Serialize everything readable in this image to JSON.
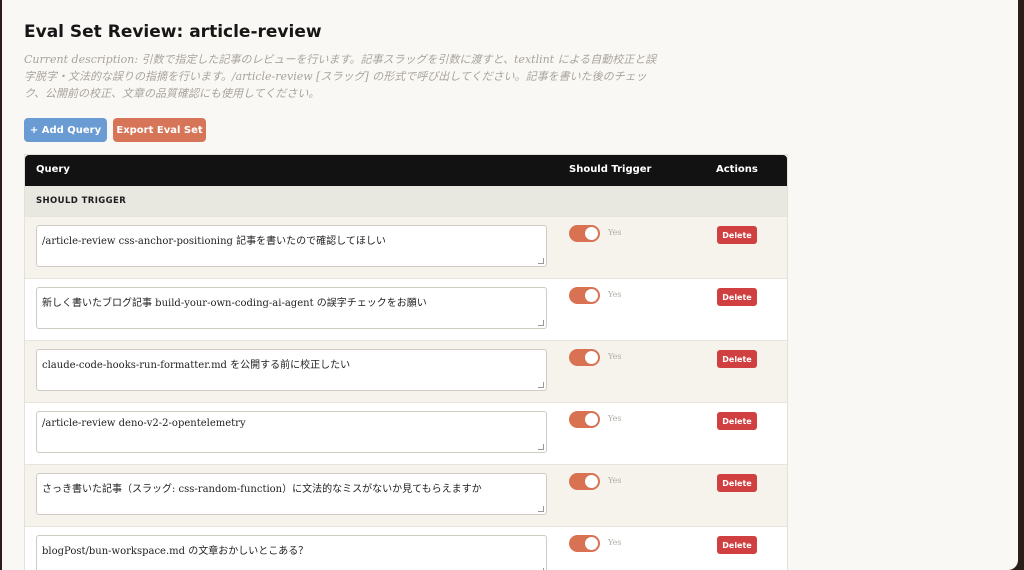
{
  "page": {
    "title": "Eval Set Review: article-review",
    "description": "Current description: 引数で指定した記事のレビューを行います。記事スラッグを引数に渡すと、textlint による自動校正と誤字脱字・文法的な誤りの指摘を行います。/article-review [スラッグ] の形式で呼び出してください。記事を書いた後のチェック、公開前の校正、文章の品質確認にも使用してください。"
  },
  "toolbar": {
    "add_label": "+ Add Query",
    "export_label": "Export Eval Set"
  },
  "table": {
    "headers": {
      "query": "Query",
      "should_trigger": "Should Trigger",
      "actions": "Actions"
    },
    "group_label": "SHOULD TRIGGER",
    "rows": [
      {
        "query": "/article-review css-anchor-positioning 記事を書いたので確認してほしい",
        "toggle_label": "Yes",
        "delete_label": "Delete",
        "trigger": true
      },
      {
        "query": "新しく書いたブログ記事 build-your-own-coding-ai-agent の誤字チェックをお願い",
        "toggle_label": "Yes",
        "delete_label": "Delete",
        "trigger": true
      },
      {
        "query": "claude-code-hooks-run-formatter.md を公開する前に校正したい",
        "toggle_label": "Yes",
        "delete_label": "Delete",
        "trigger": true
      },
      {
        "query": "/article-review deno-v2-2-opentelemetry",
        "toggle_label": "Yes",
        "delete_label": "Delete",
        "trigger": true
      },
      {
        "query": "さっき書いた記事（スラッグ: css-random-function）に文法的なミスがないか見てもらえますか",
        "toggle_label": "Yes",
        "delete_label": "Delete",
        "trigger": true
      },
      {
        "query": "blogPost/bun-workspace.md の文章おかしいとこある？",
        "toggle_label": "Yes",
        "delete_label": "Delete",
        "trigger": true
      }
    ]
  },
  "colors": {
    "add_button": "#6a9bd2",
    "export_button": "#d77558",
    "toggle_on": "#d87253",
    "delete_button": "#d04040",
    "header_bg": "#121212"
  }
}
